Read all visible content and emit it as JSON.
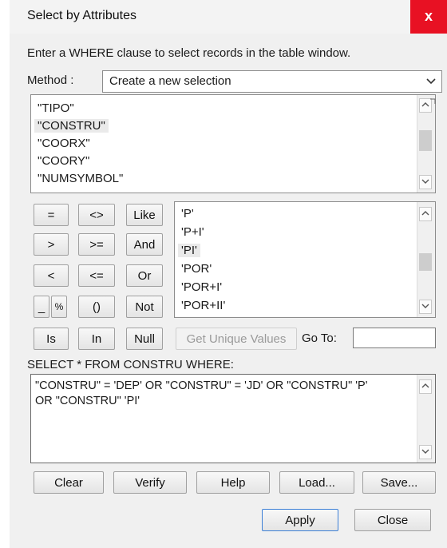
{
  "window": {
    "title": "Select by Attributes",
    "close_glyph": "x"
  },
  "instruction": "Enter a WHERE clause to select records in the table window.",
  "method": {
    "label": "Method :",
    "value": "Create a new selection"
  },
  "fields": [
    "\"TIPO\"",
    "\"CONSTRU\"",
    "\"COORX\"",
    "\"COORY\"",
    "\"NUMSYMBOL\""
  ],
  "operators": {
    "eq": "=",
    "ne": "<>",
    "like": "Like",
    "gt": ">",
    "ge": ">=",
    "and": "And",
    "lt": "<",
    "le": "<=",
    "or": "Or",
    "underscore": "_",
    "percent": "%",
    "parens": "()",
    "not": "Not",
    "is": "Is",
    "in": "In",
    "null": "Null"
  },
  "values": [
    "'P'",
    "'P+I'",
    "'PI'",
    "'POR'",
    "'POR+I'",
    "'POR+II'"
  ],
  "get_unique_values": "Get Unique Values",
  "goto_label": "Go To:",
  "goto_value": "",
  "select_label": "SELECT * FROM CONSTRU WHERE:",
  "query_lines": [
    "\"CONSTRU\" = 'DEP' OR \"CONSTRU\" = 'JD' OR \"CONSTRU\" 'P'",
    "OR \"CONSTRU\" 'PI'"
  ],
  "buttons": {
    "clear": "Clear",
    "verify": "Verify",
    "help": "Help",
    "load": "Load...",
    "save": "Save...",
    "apply": "Apply",
    "close": "Close"
  },
  "icons": {
    "scroll_up": "chevron-up-icon",
    "scroll_down": "chevron-down-icon",
    "dropdown": "chevron-down-icon"
  }
}
